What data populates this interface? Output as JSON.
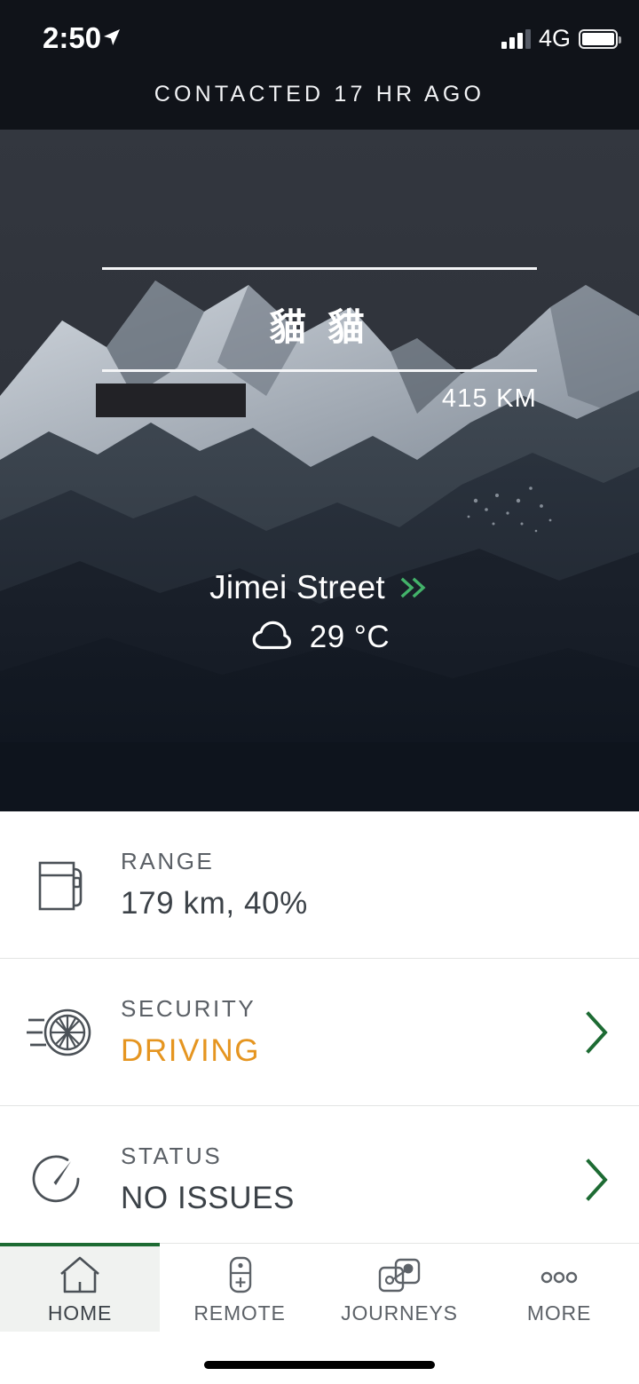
{
  "status_bar": {
    "time": "2:50",
    "location_icon": "location-arrow-icon",
    "network": "4G",
    "signal_bars_filled": 3,
    "signal_bars_total": 4,
    "battery_level": "full"
  },
  "header": {
    "contacted_text": "CONTACTED 17 HR AGO"
  },
  "hero": {
    "vehicle_name": "貓 貓",
    "plate_redacted": true,
    "odometer": "415 KM",
    "location_name": "Jimei Street",
    "location_chevron_icon": "double-chevron-right-icon",
    "weather_icon": "cloud-icon",
    "temperature": "29 °C",
    "accent_green": "#43b36a"
  },
  "list": {
    "rows": [
      {
        "icon": "fuel-pump-icon",
        "label": "RANGE",
        "value": "179 km, 40%",
        "value_color": "#3c4248",
        "has_chevron": false
      },
      {
        "icon": "wheel-motion-icon",
        "label": "SECURITY",
        "value": "DRIVING",
        "value_color": "#e59520",
        "has_chevron": true
      },
      {
        "icon": "gauge-icon",
        "label": "STATUS",
        "value": "NO ISSUES",
        "value_color": "#3c4248",
        "has_chevron": true
      }
    ],
    "chevron_color": "#1d6b33"
  },
  "tabs": [
    {
      "label": "HOME",
      "icon": "house-icon",
      "active": true
    },
    {
      "label": "REMOTE",
      "icon": "key-fob-icon",
      "active": false
    },
    {
      "label": "JOURNEYS",
      "icon": "route-cards-icon",
      "active": false
    },
    {
      "label": "MORE",
      "icon": "ellipsis-icon",
      "active": false
    }
  ]
}
